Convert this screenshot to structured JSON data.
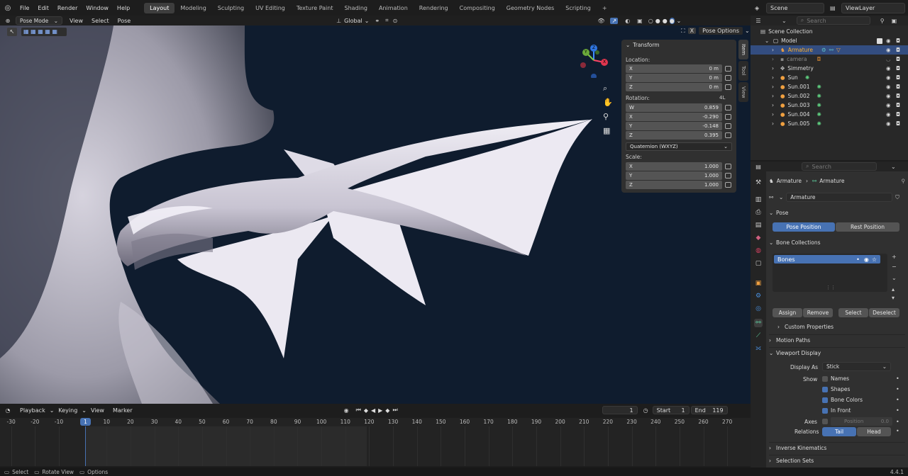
{
  "topbar": {
    "menus": [
      "File",
      "Edit",
      "Render",
      "Window",
      "Help"
    ],
    "workspaces": [
      "Layout",
      "Modeling",
      "Sculpting",
      "UV Editing",
      "Texture Paint",
      "Shading",
      "Animation",
      "Rendering",
      "Compositing",
      "Geometry Nodes",
      "Scripting"
    ],
    "add_tab": "+",
    "scene": "Scene",
    "view_layer": "ViewLayer"
  },
  "viewport_header": {
    "mode": "Pose Mode",
    "menus": [
      "View",
      "Select",
      "Pose"
    ],
    "orientation": "Global",
    "pose_options": "Pose Options"
  },
  "gizmo": {
    "x": "X",
    "y": "Y",
    "z": "Z"
  },
  "npanel": {
    "title": "Transform",
    "location_label": "Location:",
    "location": [
      {
        "axis": "X",
        "value": "0 m"
      },
      {
        "axis": "Y",
        "value": "0 m"
      },
      {
        "axis": "Z",
        "value": "0 m"
      }
    ],
    "rotation_label": "Rotation:",
    "rotation_4l": "4L",
    "rotation": [
      {
        "axis": "W",
        "value": "0.859"
      },
      {
        "axis": "X",
        "value": "-0.290"
      },
      {
        "axis": "Y",
        "value": "-0.148"
      },
      {
        "axis": "Z",
        "value": "0.395"
      }
    ],
    "rotation_mode": "Quaternion (WXYZ)",
    "scale_label": "Scale:",
    "scale": [
      {
        "axis": "X",
        "value": "1.000"
      },
      {
        "axis": "Y",
        "value": "1.000"
      },
      {
        "axis": "Z",
        "value": "1.000"
      }
    ],
    "tabs": [
      "Item",
      "Tool",
      "View"
    ]
  },
  "timeline": {
    "menus": [
      "Playback",
      "Keying",
      "View",
      "Marker"
    ],
    "current_frame": "1",
    "start_label": "Start",
    "start": "1",
    "end_label": "End",
    "end": "119",
    "ticks": [
      "-30",
      "-20",
      "-10",
      "1",
      "10",
      "20",
      "30",
      "40",
      "50",
      "60",
      "70",
      "80",
      "90",
      "100",
      "110",
      "120",
      "130",
      "140",
      "150",
      "160",
      "170",
      "180",
      "190",
      "200",
      "210",
      "220",
      "230",
      "240",
      "250",
      "260",
      "270"
    ]
  },
  "status": {
    "select": "Select",
    "rotate": "Rotate View",
    "options": "Options",
    "version": "4.4.1"
  },
  "outliner": {
    "search_placeholder": "Search",
    "scene_collection": "Scene Collection",
    "items": [
      {
        "name": "Model",
        "level": 1
      },
      {
        "name": "Armature",
        "level": 2
      },
      {
        "name": "camera",
        "level": 2
      },
      {
        "name": "Simmetry",
        "level": 2
      },
      {
        "name": "Sun",
        "level": 2
      },
      {
        "name": "Sun.001",
        "level": 2
      },
      {
        "name": "Sun.002",
        "level": 2
      },
      {
        "name": "Sun.003",
        "level": 2
      },
      {
        "name": "Sun.004",
        "level": 2
      },
      {
        "name": "Sun.005",
        "level": 2
      }
    ]
  },
  "properties": {
    "search_placeholder": "Search",
    "breadcrumb": [
      "Armature",
      "Armature"
    ],
    "datablock": "Armature",
    "pose_section": "Pose",
    "pose_position": "Pose Position",
    "rest_position": "Rest Position",
    "bone_collections": "Bone Collections",
    "bones": "Bones",
    "assign": "Assign",
    "remove": "Remove",
    "select": "Select",
    "deselect": "Deselect",
    "custom_properties": "Custom Properties",
    "motion_paths": "Motion Paths",
    "viewport_display": "Viewport Display",
    "display_as_label": "Display As",
    "display_as": "Stick",
    "show_label": "Show",
    "names": "Names",
    "shapes": "Shapes",
    "bone_colors": "Bone Colors",
    "in_front": "In Front",
    "axes_label": "Axes",
    "position_label": "Position",
    "position_value": "0.0",
    "relations_label": "Relations",
    "tail": "Tail",
    "head": "Head",
    "inverse_kinematics": "Inverse Kinematics",
    "selection_sets": "Selection Sets"
  }
}
